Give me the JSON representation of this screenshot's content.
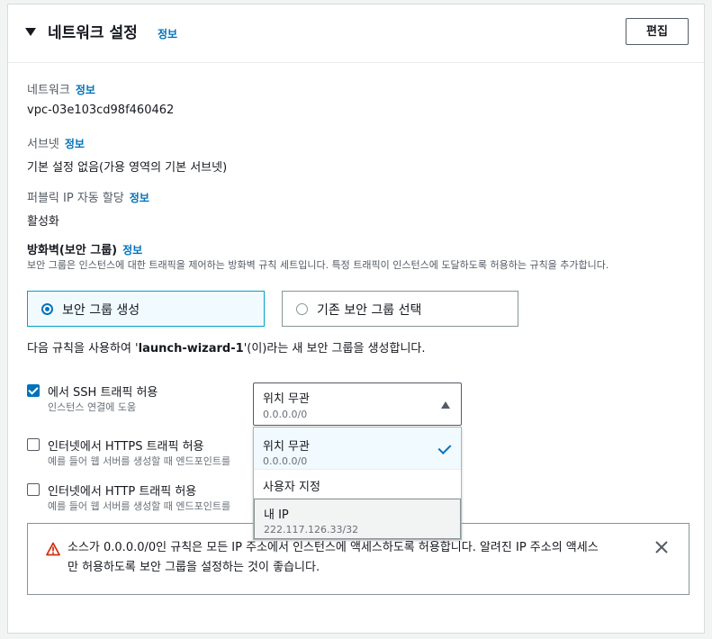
{
  "header": {
    "title": "네트워크 설정",
    "info": "정보",
    "edit_label": "편집"
  },
  "fields": {
    "network": {
      "label": "네트워크",
      "info": "정보",
      "value": "vpc-03e103cd98f460462"
    },
    "subnet": {
      "label": "서브넷",
      "info": "정보",
      "value": "기본 설정 없음(가용 영역의 기본 서브넷)"
    },
    "public_ip": {
      "label": "퍼블릭 IP 자동 할당",
      "info": "정보",
      "value": "활성화"
    }
  },
  "firewall": {
    "title": "방화벽(보안 그룹)",
    "info": "정보",
    "description": "보안 그룹은 인스턴스에 대한 트래픽을 제어하는 방화벽 규칙 세트입니다. 특정 트래픽이 인스턴스에 도달하도록 허용하는 규칙을 추가합니다.",
    "options": [
      {
        "label": "보안 그룹 생성",
        "selected": true
      },
      {
        "label": "기존 보안 그룹 선택",
        "selected": false
      }
    ],
    "rule_prefix": "다음 규칙을 사용하여 '",
    "rule_name": "launch-wizard-1",
    "rule_suffix": "'(이)라는 새 보안 그룹을 생성합니다."
  },
  "rules": [
    {
      "label": "에서 SSH 트래픽 허용",
      "sub": "인스턴스 연결에 도움",
      "checked": true
    },
    {
      "label": "인터넷에서 HTTPS 트래픽 허용",
      "sub": "예를 들어 웹 서버를 생성할 때 엔드포인트를",
      "checked": false
    },
    {
      "label": "인터넷에서 HTTP 트래픽 허용",
      "sub": "예를 들어 웹 서버를 생성할 때 엔드포인트를",
      "checked": false
    }
  ],
  "source_select": {
    "value": "위치 무관",
    "sub": "0.0.0.0/0",
    "options": [
      {
        "label": "위치 무관",
        "sub": "0.0.0.0/0",
        "selected": true
      },
      {
        "label": "사용자 지정",
        "sub": ""
      },
      {
        "label": "내 IP",
        "sub": "222.117.126.33/32"
      }
    ]
  },
  "alert": {
    "text": "소스가 0.0.0.0/0인 규칙은 모든 IP 주소에서 인스턴스에 액세스하도록 허용합니다. 알려진 IP 주소의 액세스만 허용하도록 보안 그룹을 설정하는 것이 좋습니다.",
    "icon": "warning-icon"
  },
  "colors": {
    "accent": "#0073bb",
    "warning": "#d13212"
  }
}
